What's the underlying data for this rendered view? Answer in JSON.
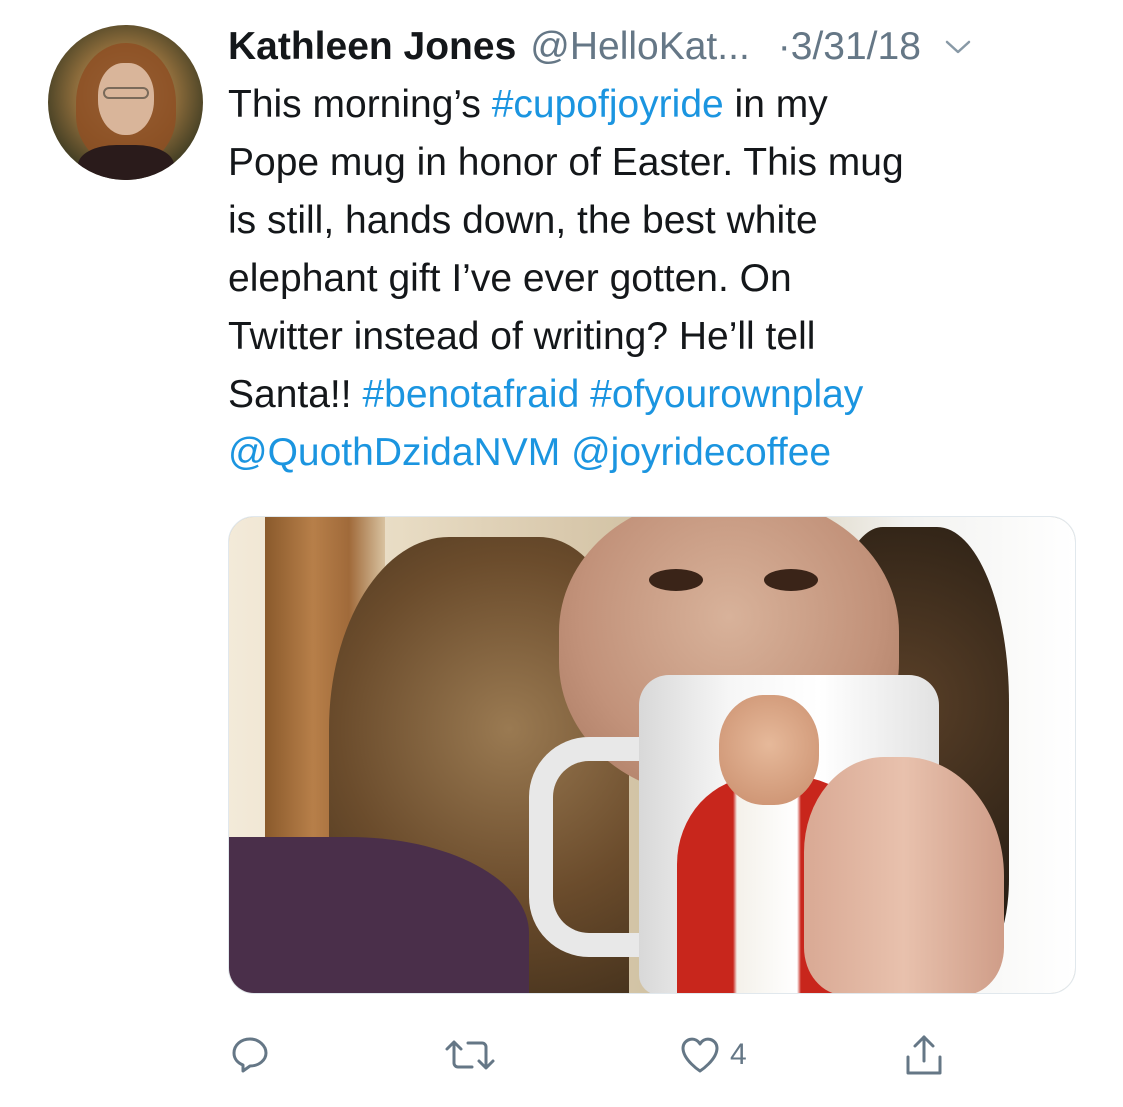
{
  "tweet": {
    "display_name": "Kathleen Jones",
    "handle": "@HelloKat...",
    "date": "·3/31/18",
    "lines": [
      [
        {
          "text": "This morning’s "
        },
        {
          "text": "#cupofjoyride",
          "link": true
        },
        {
          "text": " in my"
        }
      ],
      [
        {
          "text": "Pope mug in honor of Easter. This mug"
        }
      ],
      [
        {
          "text": "is still, hands down, the best white"
        }
      ],
      [
        {
          "text": "elephant gift I’ve ever gotten. On"
        }
      ],
      [
        {
          "text": "Twitter instead of writing? He’ll tell"
        }
      ],
      [
        {
          "text": "Santa!! "
        },
        {
          "text": "#benotafraid",
          "link": true
        },
        {
          "text": " "
        },
        {
          "text": "#ofyourownplay",
          "link": true
        }
      ],
      [
        {
          "text": "@QuothDzidaNVM",
          "link": true
        },
        {
          "text": " "
        },
        {
          "text": "@joyridecoffee",
          "link": true
        }
      ]
    ]
  },
  "actions": {
    "reply_icon": "reply-icon",
    "retweet_icon": "retweet-icon",
    "like_icon": "heart-icon",
    "like_count": "4",
    "share_icon": "share-icon"
  },
  "colors": {
    "link": "#1b95e0",
    "secondary": "#657786",
    "text": "#14171a"
  }
}
